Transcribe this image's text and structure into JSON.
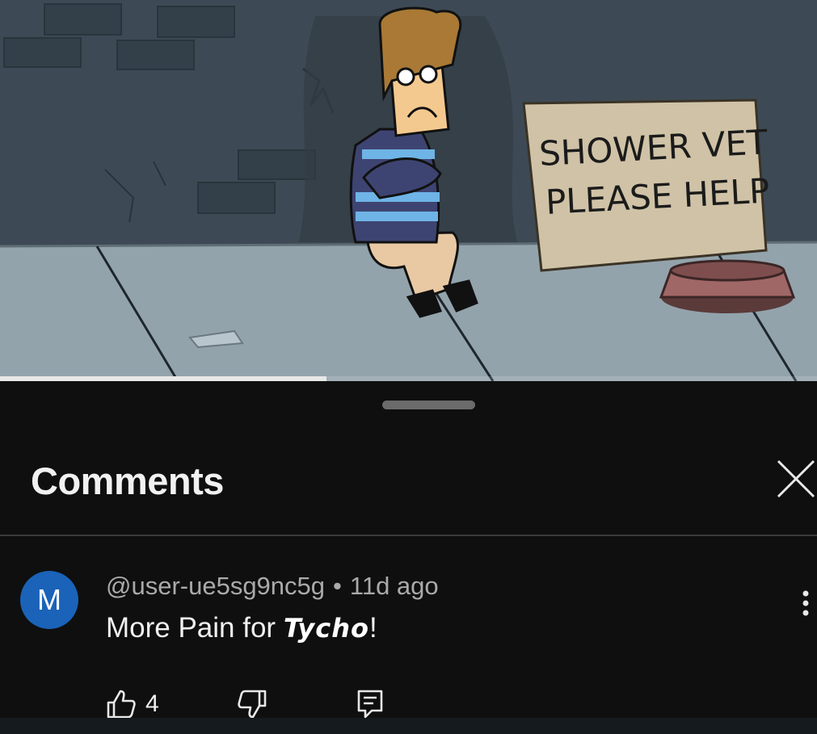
{
  "video": {
    "sign_line1": "SHOWER VET",
    "sign_line2": "PLEASE HELP",
    "progress": 0.4
  },
  "panel": {
    "title": "Comments",
    "close_icon": "close-icon"
  },
  "comment": {
    "avatar_letter": "M",
    "avatar_color": "#1a63b8",
    "username": "@user-ue5sg9nc5g",
    "separator": "•",
    "time": "11d ago",
    "text_prefix": "More Pain for",
    "text_handwritten": "Tycho",
    "text_suffix": "!",
    "likes": "4",
    "icons": [
      "thumbs-up-icon",
      "thumbs-down-icon",
      "reply-icon",
      "more-vertical-icon"
    ]
  }
}
